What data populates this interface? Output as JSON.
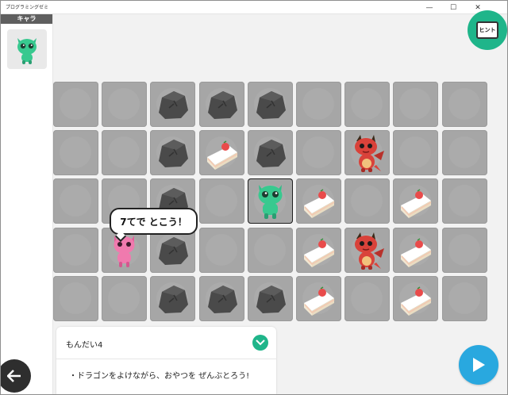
{
  "window": {
    "title": "プログラミングゼミ",
    "minimize_glyph": "—",
    "maximize_glyph": "☐",
    "close_glyph": "✕"
  },
  "sidebar": {
    "header": "キャラ",
    "character_icon": "green-monster-icon"
  },
  "hint_button": {
    "label": "ヒント",
    "icon": "tv-icon"
  },
  "board": {
    "rows": 5,
    "cols": 9,
    "cells": [
      [
        "",
        "",
        "rock",
        "rock",
        "rock",
        "",
        "",
        "",
        ""
      ],
      [
        "",
        "",
        "rock",
        "cake",
        "rock",
        "",
        "dragon",
        "",
        ""
      ],
      [
        "",
        "",
        "rock",
        "",
        "player",
        "cake",
        "",
        "cake",
        ""
      ],
      [
        "",
        "pink-monster",
        "rock",
        "",
        "",
        "cake",
        "dragon",
        "cake",
        ""
      ],
      [
        "",
        "",
        "rock",
        "rock",
        "rock",
        "cake",
        "",
        "cake",
        ""
      ]
    ]
  },
  "speech_bubble": {
    "text": "7てで とこう！"
  },
  "mission_panel": {
    "title": "もんだい4",
    "task": "・ドラゴンをよけながら、おやつを ぜんぶとろう!"
  },
  "colors": {
    "tile": "#a6a6a6",
    "accent_green": "#1fb58a",
    "play_blue": "#29a8df",
    "back_dark": "#2e2e2e"
  },
  "controls": {
    "back_icon": "arrow-left-icon",
    "play_icon": "play-icon"
  }
}
